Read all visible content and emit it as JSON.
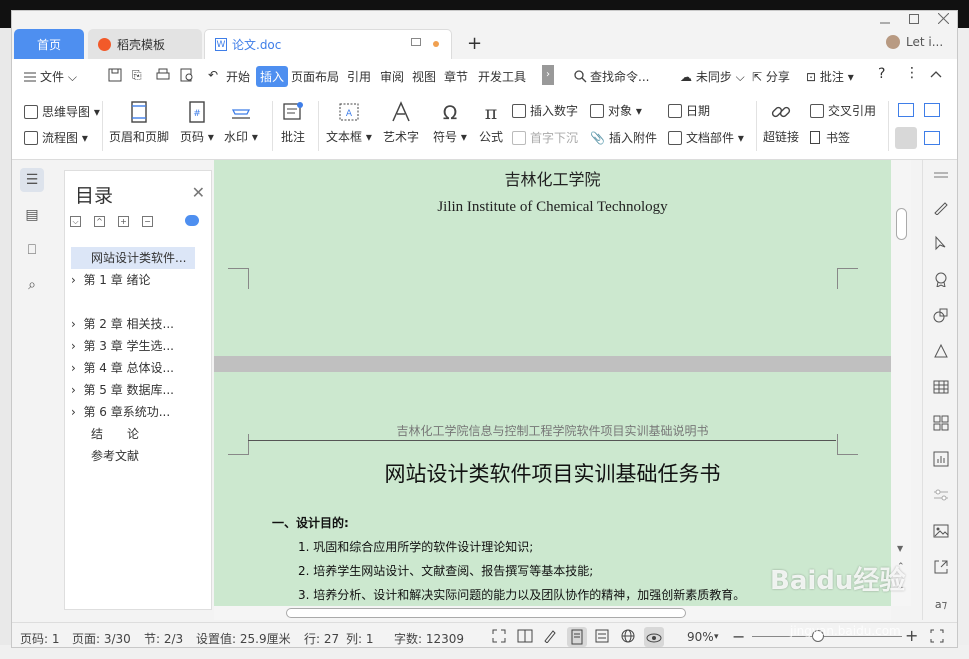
{
  "tabs": {
    "home": "首页",
    "template": "稻壳模板",
    "document": "论文.doc"
  },
  "user": {
    "name": "Let i..."
  },
  "menu": {
    "file": "文件",
    "start": "开始",
    "insert": "插入",
    "layout": "页面布局",
    "reference": "引用",
    "review": "审阅",
    "view": "视图",
    "chapter": "章节",
    "devtools": "开发工具",
    "search": "查找命令...",
    "sync": "未同步",
    "share": "分享",
    "comment": "批注"
  },
  "toolbar": {
    "mindmap": "思维导图",
    "flowchart": "流程图",
    "header_footer": "页眉和页脚",
    "page_number": "页码",
    "watermark": "水印",
    "annotation": "批注",
    "textbox": "文本框",
    "wordart": "艺术字",
    "symbol": "符号",
    "formula": "公式",
    "insert_number": "插入数字",
    "object": "对象",
    "date": "日期",
    "dropcap": "首字下沉",
    "attachment": "插入附件",
    "doc_parts": "文档部件",
    "hyperlink": "超链接",
    "crossref": "交叉引用",
    "bookmark": "书签"
  },
  "nav": {
    "title": "目录",
    "items": [
      "网站设计类软件...",
      "第 1 章  绪论",
      "第 2 章  相关技...",
      "第 3 章  学生选...",
      "第 4 章  总体设...",
      "第 5 章  数据库...",
      "第 6 章系统功...",
      "结　　论",
      "参考文献"
    ]
  },
  "document": {
    "page1_line1": "吉林化工学院",
    "page1_line2": "Jilin Institute of Chemical Technology",
    "header_text": "吉林化工学院信息与控制工程学院软件项目实训基础说明书",
    "title": "网站设计类软件项目实训基础任务书",
    "section1": "一、设计目的:",
    "items": [
      "1. 巩固和综合应用所学的软件设计理论知识;",
      "2. 培养学生网站设计、文献查阅、报告撰写等基本技能;",
      "3. 培养分析、设计和解决实际问题的能力以及团队协作的精神，加强创新素质教育。"
    ]
  },
  "status": {
    "page_num": "页码: 1",
    "pages": "页面: 3/30",
    "section": "节: 2/3",
    "setting": "设置值: 25.9厘米",
    "row": "行: 27",
    "col": "列: 1",
    "words": "字数: 12309",
    "zoom": "90%"
  },
  "watermark": {
    "text": "Baidu经验",
    "url": "jingyan.baidu.com"
  }
}
